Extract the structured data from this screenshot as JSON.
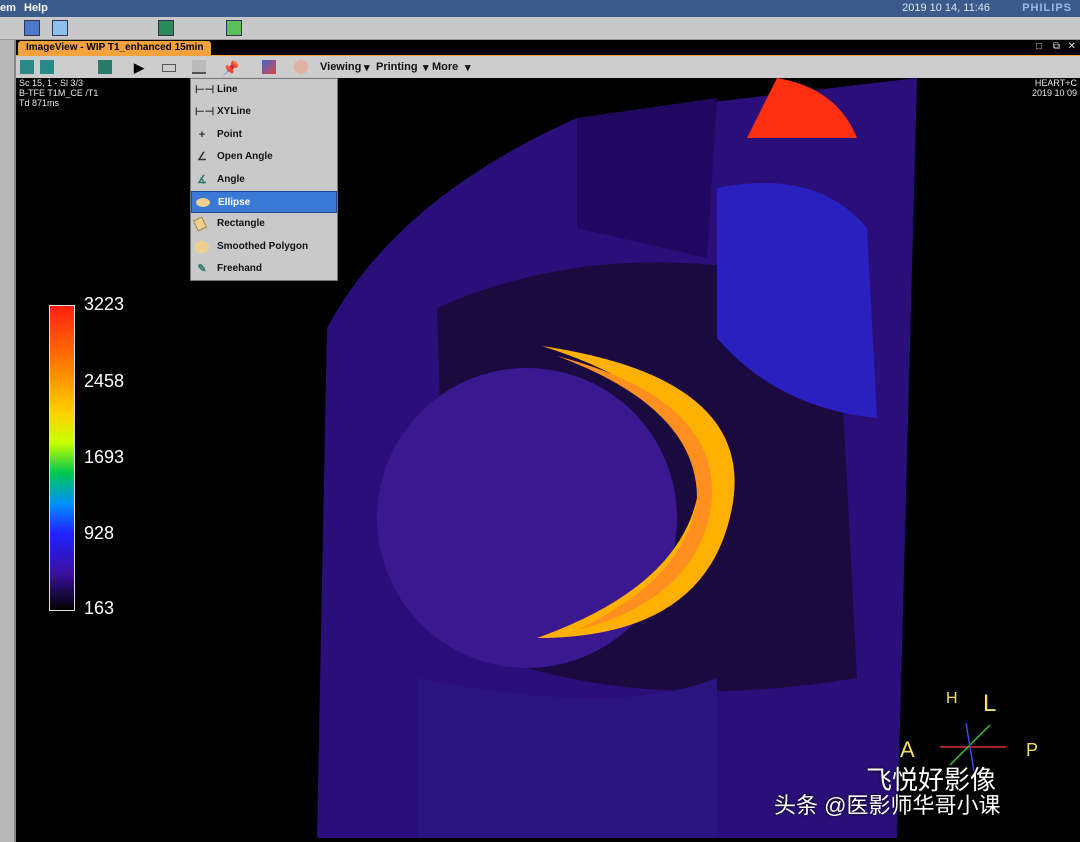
{
  "menubar": {
    "items": [
      "em",
      "Help"
    ],
    "datetime": "2019 10 14, 11:46",
    "brand": "PHILIPS"
  },
  "window": {
    "tab_title": "ImageView - WIP T1_enhanced 15min",
    "controls": [
      "□",
      "⧉",
      "✕"
    ]
  },
  "viewer_toolbar": {
    "viewing": "Viewing",
    "printing": "Printing",
    "more": "More",
    "dropdown_arrow": "▾"
  },
  "overlay": {
    "top_left": [
      "Sc 15, 1 - Sl 3/3",
      "B-TFE T1M_CE    /T1",
      "Td 871ms"
    ],
    "top_right": [
      "HEART+C",
      "2019 10 09"
    ]
  },
  "measure_menu": {
    "selected": "Ellipse",
    "items": [
      {
        "label": "Line",
        "icon": "line-icon"
      },
      {
        "label": "XYLine",
        "icon": "xyline-icon"
      },
      {
        "label": "Point",
        "icon": "plus-icon"
      },
      {
        "label": "Open Angle",
        "icon": "open-angle-icon"
      },
      {
        "label": "Angle",
        "icon": "angle-icon"
      },
      {
        "label": "Ellipse",
        "icon": "ellipse-icon"
      },
      {
        "label": "Rectangle",
        "icon": "rectangle-icon"
      },
      {
        "label": "Smoothed Polygon",
        "icon": "polygon-icon"
      },
      {
        "label": "Freehand",
        "icon": "freehand-icon"
      }
    ]
  },
  "colorbar": {
    "labels": [
      "3223",
      "2458",
      "1693",
      "928",
      "163"
    ],
    "max": 3223,
    "min": 163
  },
  "orientation": {
    "H": "H",
    "L": "L",
    "A": "A",
    "P": "P"
  },
  "watermark": {
    "line1": "飞悦好影像",
    "line2": "头条 @医影师华哥小课"
  }
}
